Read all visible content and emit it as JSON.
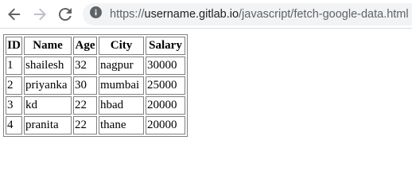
{
  "browser": {
    "url_scheme": "https://",
    "url_host": "username.gitlab.io",
    "url_path": "/javascript/fetch-google-data.html"
  },
  "table": {
    "headers": [
      "ID",
      "Name",
      "Age",
      "City",
      "Salary"
    ],
    "rows": [
      [
        "1",
        "shailesh",
        "32",
        "nagpur",
        "30000"
      ],
      [
        "2",
        "priyanka",
        "30",
        "mumbai",
        "25000"
      ],
      [
        "3",
        "kd",
        "22",
        "hbad",
        "20000"
      ],
      [
        "4",
        "pranita",
        "22",
        "thane",
        "20000"
      ]
    ]
  },
  "icons": {
    "back": "arrow-left-icon",
    "forward": "arrow-right-icon",
    "reload": "reload-icon",
    "site_info": "info-icon"
  },
  "colors": {
    "toolbar_icon": "#5f6368",
    "forward_disabled": "#bdc1c6",
    "omnibox_bg": "#f1f3f4",
    "table_border": "#808080"
  }
}
